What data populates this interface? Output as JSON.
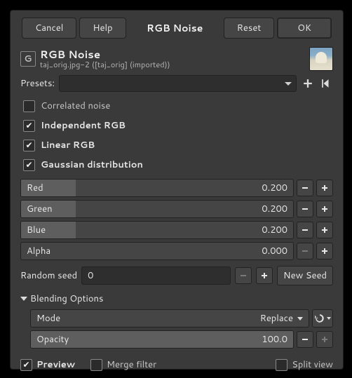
{
  "actions": {
    "cancel": "Cancel",
    "help": "Help",
    "title": "RGB Noise",
    "reset": "Reset",
    "ok": "OK"
  },
  "header": {
    "title": "RGB Noise",
    "subtitle": "taj_orig.jpg-2 ([taj_orig] (imported))"
  },
  "presets_label": "Presets:",
  "options": {
    "correlated": {
      "label": "Correlated noise",
      "checked": false
    },
    "independent": {
      "label": "Independent RGB",
      "checked": true
    },
    "linear": {
      "label": "Linear RGB",
      "checked": true
    },
    "gaussian": {
      "label": "Gaussian distribution",
      "checked": true
    }
  },
  "channels": {
    "red": {
      "label": "Red",
      "value": "0.200",
      "fill_pct": 20
    },
    "green": {
      "label": "Green",
      "value": "0.200",
      "fill_pct": 20
    },
    "blue": {
      "label": "Blue",
      "value": "0.200",
      "fill_pct": 20
    },
    "alpha": {
      "label": "Alpha",
      "value": "0.000",
      "fill_pct": 0
    }
  },
  "seed": {
    "label": "Random seed",
    "value": "0",
    "new_seed": "New Seed"
  },
  "blending": {
    "title": "Blending Options",
    "mode_label": "Mode",
    "mode_value": "Replace",
    "opacity_label": "Opacity",
    "opacity_value": "100.0"
  },
  "footer": {
    "preview": {
      "label": "Preview",
      "checked": true
    },
    "merge": {
      "label": "Merge filter",
      "checked": false
    },
    "split": {
      "label": "Split view",
      "checked": false
    }
  }
}
